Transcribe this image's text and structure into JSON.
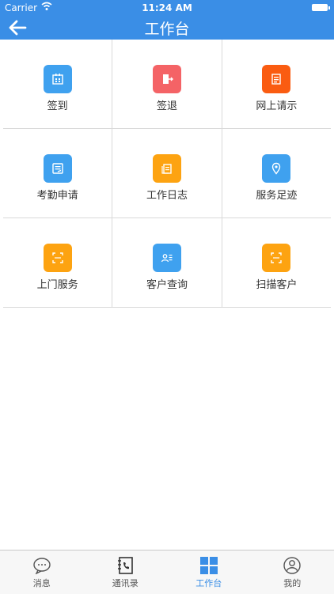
{
  "status_bar": {
    "carrier": "Carrier",
    "time": "11:24 AM"
  },
  "nav": {
    "title": "工作台"
  },
  "grid": {
    "items": [
      {
        "label": "签到",
        "icon": "calendar-icon",
        "color": "#3fa1ef"
      },
      {
        "label": "签退",
        "icon": "exit-door-icon",
        "color": "#f46366"
      },
      {
        "label": "网上请示",
        "icon": "document-icon",
        "color": "#fa5c11"
      },
      {
        "label": "考勤申请",
        "icon": "edit-form-icon",
        "color": "#3fa1ef"
      },
      {
        "label": "工作日志",
        "icon": "log-icon",
        "color": "#fda311"
      },
      {
        "label": "服务足迹",
        "icon": "location-pin-icon",
        "color": "#3fa1ef"
      },
      {
        "label": "上门服务",
        "icon": "scan-frame-icon",
        "color": "#fda311"
      },
      {
        "label": "客户查询",
        "icon": "contact-card-icon",
        "color": "#3fa1ef"
      },
      {
        "label": "扫描客户",
        "icon": "scan-frame-icon",
        "color": "#fda311"
      }
    ]
  },
  "tabs": [
    {
      "label": "消息",
      "icon": "chat-bubble-icon"
    },
    {
      "label": "通讯录",
      "icon": "address-book-icon"
    },
    {
      "label": "工作台",
      "icon": "grid-icon",
      "active": true
    },
    {
      "label": "我的",
      "icon": "user-profile-icon"
    }
  ],
  "colors": {
    "primary": "#3a8ee6"
  }
}
